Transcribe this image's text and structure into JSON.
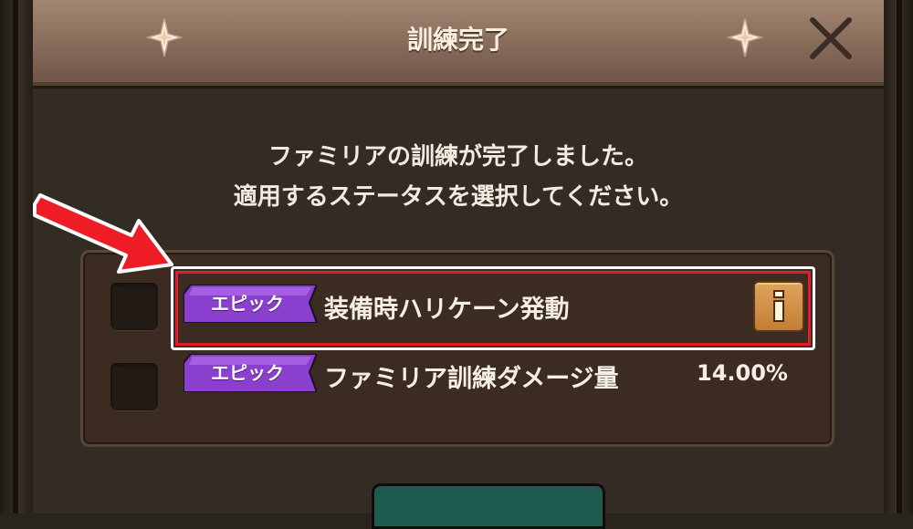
{
  "dialog": {
    "title": "訓練完了",
    "message_line1": "ファミリアの訓練が完了しました。",
    "message_line2": "適用するステータスを選択してください。"
  },
  "options": [
    {
      "rarity": "エピック",
      "label": "装備時ハリケーン発動",
      "value": "",
      "selected": false,
      "has_info": true,
      "highlighted": true
    },
    {
      "rarity": "エピック",
      "label": "ファミリア訓練ダメージ量",
      "value": "14.00%",
      "selected": false,
      "has_info": false,
      "highlighted": false
    }
  ],
  "icons": {
    "title_decor": "sparkle-icon",
    "close": "close-icon",
    "info": "info-icon",
    "annotation": "red-arrow-icon"
  },
  "colors": {
    "rarity_epic": "#8a3fcf",
    "highlight_inner": "#e31c2b",
    "highlight_outer": "#ffffff",
    "confirm_button": "#1f5a4e"
  }
}
